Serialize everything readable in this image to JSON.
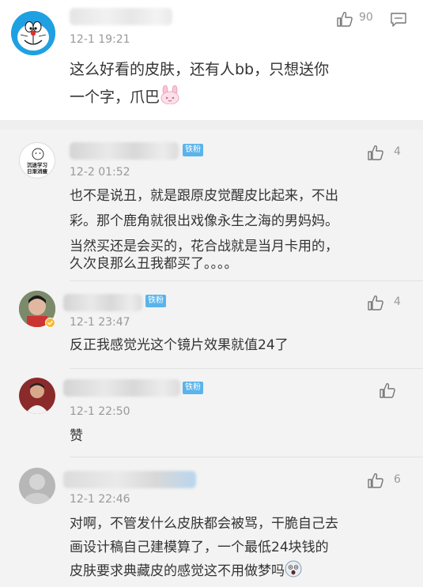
{
  "main_comment": {
    "time": "12-1 19:21",
    "like_count": "90",
    "text_line1": "这么好看的皮肤，还有人bb，只想送你",
    "text_line2": "一个字，爪巴"
  },
  "replies": [
    {
      "avatar_text_line1": "沉迷学习",
      "avatar_text_line2": "日渐消瘦",
      "badge": "铁粉",
      "time": "12-2 01:52",
      "like_count": "4",
      "text_lines": [
        "也不是说丑，就是跟原皮觉醒皮比起来，不出",
        "彩。那个鹿角就很出戏像永生之海的男妈妈。",
        "当然买还是会买的，花合战就是当月卡用的，",
        "久次良那么丑我都买了。。。。"
      ]
    },
    {
      "badge": "铁粉",
      "time": "12-1 23:47",
      "like_count": "4",
      "text_lines": [
        "反正我感觉光这个镜片效果就值24了"
      ]
    },
    {
      "badge": "铁粉",
      "time": "12-1 22:50",
      "like_count": "",
      "text_lines": [
        "赞"
      ]
    },
    {
      "time": "12-1 22:46",
      "like_count": "6",
      "text_lines": [
        "对啊，不管发什么皮肤都会被骂，干脆自己去",
        "画设计稿自己建模算了，一个最低24块钱的",
        "皮肤要求典藏皮的感觉这不用做梦吗"
      ]
    }
  ],
  "icons": {
    "like": "thumbs-up-icon",
    "comment": "comment-bubble-icon",
    "emoji1": "pink-bunny-emoji-icon",
    "emoji2": "frightened-face-emoji-icon"
  },
  "colors": {
    "badge": "#5ab3ea",
    "doraemon_blue": "#1fa0e3"
  }
}
